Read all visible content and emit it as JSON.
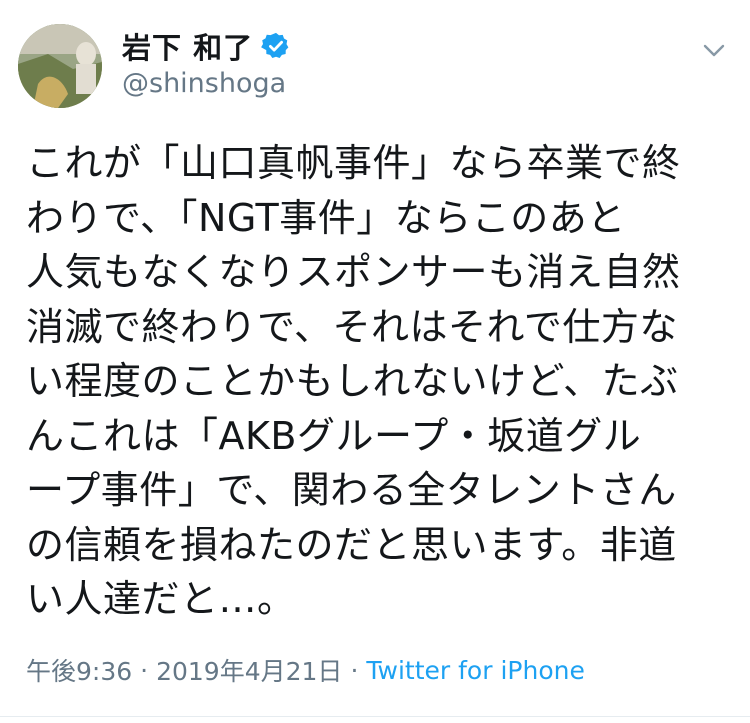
{
  "user": {
    "display_name": "岩下 和了",
    "handle": "@shinshoga",
    "verified": true,
    "avatar_icon": "avatar-photo"
  },
  "tweet": {
    "text": "これが「山口真帆事件」なら卒業で終\nわりで、「NGT事件」ならこのあと\n人気もなくなりスポンサーも消え自然\n消滅で終わりで、それはそれで仕方な\nい程度のことかもしれないけど、たぶ\nんこれは「AKBグループ・坂道グル\nープ事件」で、関わる全タレントさん\nの信頼を損ねたのだと思います。非道\nい人達だと…。"
  },
  "meta": {
    "time": "午後9:36",
    "separator": "·",
    "date": "2019年4月21日",
    "source": "Twitter for iPhone"
  },
  "colors": {
    "verified": "#1da1f2",
    "secondary_text": "#657786",
    "link": "#1da1f2"
  }
}
